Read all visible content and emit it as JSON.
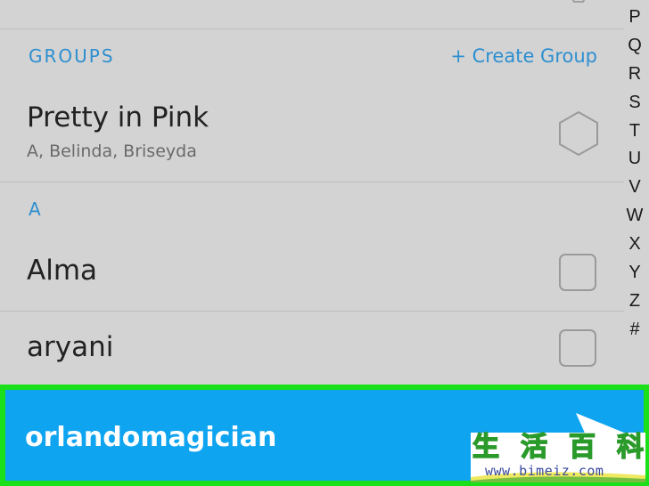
{
  "groups_section": {
    "label": "GROUPS",
    "create_group_label": "+ Create Group"
  },
  "group_row": {
    "title": "Pretty in Pink",
    "members": "A, Belinda, Briseyda"
  },
  "letter_section": {
    "label": "A"
  },
  "contacts": [
    {
      "name": "Alma"
    },
    {
      "name": "aryani"
    }
  ],
  "selected_contact": {
    "name": "orlandomagician"
  },
  "alphabet_index": [
    "P",
    "Q",
    "R",
    "S",
    "T",
    "U",
    "V",
    "W",
    "X",
    "Y",
    "Z",
    "#"
  ],
  "watermark": {
    "chars": [
      "生",
      "活",
      "百",
      "科"
    ],
    "url": "www.bimeiz.com"
  },
  "colors": {
    "background": "#d3d3d3",
    "accent_blue": "#2d8fd1",
    "selected_row": "#0fa4f0",
    "highlight_border": "#19e019"
  }
}
